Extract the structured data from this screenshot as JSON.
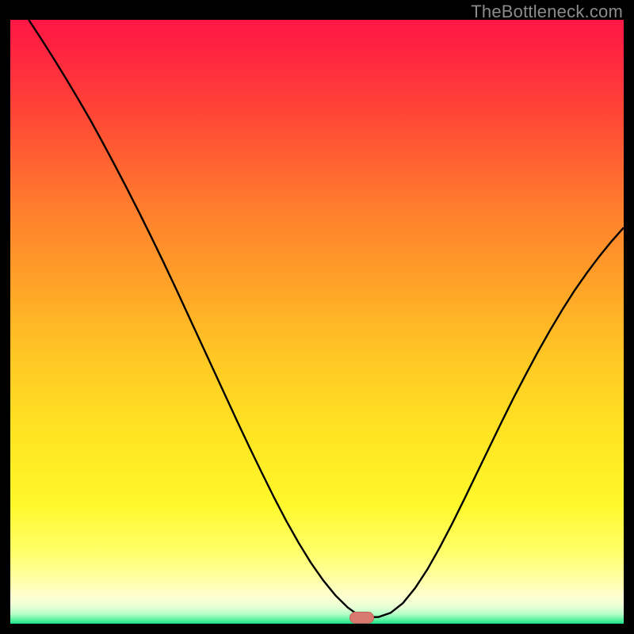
{
  "watermark": "TheBottleneck.com",
  "colors": {
    "frame": "#000000",
    "curve": "#000000",
    "marker_fill": "#d97a70",
    "marker_stroke": "#c46056",
    "gradient_stops": [
      {
        "offset": 0.0,
        "color": "#ff1744"
      },
      {
        "offset": 0.07,
        "color": "#ff2a3e"
      },
      {
        "offset": 0.17,
        "color": "#ff4b35"
      },
      {
        "offset": 0.3,
        "color": "#ff7a2d"
      },
      {
        "offset": 0.43,
        "color": "#ffa028"
      },
      {
        "offset": 0.56,
        "color": "#ffc824"
      },
      {
        "offset": 0.68,
        "color": "#ffe322"
      },
      {
        "offset": 0.8,
        "color": "#fff82a"
      },
      {
        "offset": 0.88,
        "color": "#ffff68"
      },
      {
        "offset": 0.928,
        "color": "#ffffa8"
      },
      {
        "offset": 0.955,
        "color": "#fdffd0"
      },
      {
        "offset": 0.972,
        "color": "#e9ffd6"
      },
      {
        "offset": 0.984,
        "color": "#b6ffc8"
      },
      {
        "offset": 0.992,
        "color": "#6bf5a9"
      },
      {
        "offset": 1.0,
        "color": "#18e084"
      }
    ]
  },
  "chart_data": {
    "type": "line",
    "title": "",
    "xlabel": "",
    "ylabel": "",
    "xlim": [
      0,
      100
    ],
    "ylim": [
      0,
      100
    ],
    "x": [
      3,
      5,
      7,
      9,
      11,
      13,
      15,
      17,
      19,
      21,
      23,
      25,
      27,
      29,
      31,
      33,
      35,
      37,
      39,
      41,
      43,
      45,
      47,
      49,
      51,
      53,
      55,
      56.5,
      58,
      60,
      62,
      64,
      66,
      68,
      70,
      72,
      74,
      76,
      78,
      80,
      82,
      84,
      86,
      88,
      90,
      92,
      94,
      96,
      98,
      100
    ],
    "values": [
      100,
      96.9,
      93.7,
      90.4,
      87.0,
      83.5,
      79.8,
      76.0,
      72.1,
      68.1,
      64.0,
      59.8,
      55.5,
      51.1,
      46.7,
      42.3,
      37.9,
      33.5,
      29.2,
      25.0,
      20.9,
      17.0,
      13.4,
      10.1,
      7.2,
      4.7,
      2.7,
      1.6,
      1.1,
      1.1,
      1.8,
      3.4,
      5.9,
      9.0,
      12.6,
      16.5,
      20.6,
      24.8,
      29.0,
      33.2,
      37.3,
      41.2,
      45.0,
      48.6,
      52.0,
      55.2,
      58.1,
      60.8,
      63.3,
      65.6
    ],
    "marker": {
      "x": 57.3,
      "y": 1.0
    },
    "grid": false,
    "legend": false
  }
}
